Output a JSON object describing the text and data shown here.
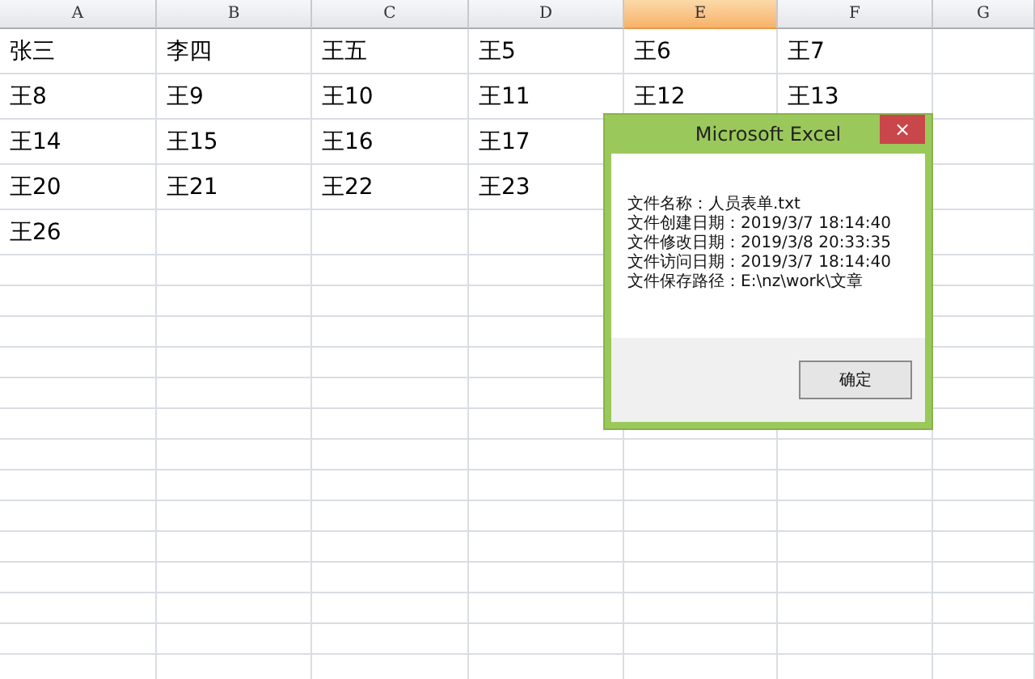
{
  "columns": [
    {
      "label": "A",
      "selected": false
    },
    {
      "label": "B",
      "selected": false
    },
    {
      "label": "C",
      "selected": false
    },
    {
      "label": "D",
      "selected": false
    },
    {
      "label": "E",
      "selected": true
    },
    {
      "label": "F",
      "selected": false
    },
    {
      "label": "G",
      "selected": false
    }
  ],
  "rows": [
    [
      "张三",
      "李四",
      "王五",
      "王5",
      "王6",
      "王7"
    ],
    [
      "王8",
      "王9",
      "王10",
      "王11",
      "王12",
      "王13"
    ],
    [
      "王14",
      "王15",
      "王16",
      "王17"
    ],
    [
      "王20",
      "王21",
      "王22",
      "王23"
    ],
    [
      "王26"
    ]
  ],
  "dialog": {
    "title": "Microsoft Excel",
    "close": "×",
    "lines": [
      "文件名称：人员表单.txt",
      "文件创建日期：2019/3/7 18:14:40",
      "文件修改日期：2019/3/8 20:33:35",
      "文件访问日期：2019/3/7 18:14:40",
      "文件保存路径：E:\\nz\\work\\文章"
    ],
    "button": "确定"
  }
}
